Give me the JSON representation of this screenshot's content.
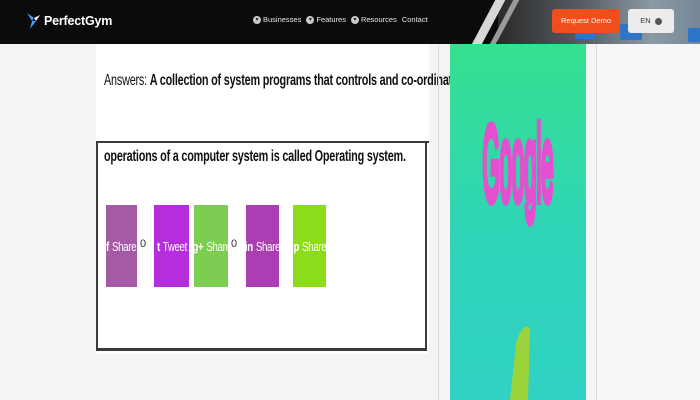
{
  "header": {
    "brand": "PerfectGym",
    "nav": [
      {
        "label": "Businesses",
        "icon": "circle-arrow-icon"
      },
      {
        "label": "Features",
        "icon": "circle-arrow-icon"
      },
      {
        "label": "Resources",
        "icon": "circle-arrow-icon"
      },
      {
        "label": "Contact",
        "icon": ""
      }
    ],
    "cta_label": "Request Demo",
    "lang_label": "EN",
    "colors": {
      "bar": "#0b0b0b",
      "cta": "#f04e1c",
      "lang_bg": "#ececec"
    }
  },
  "article": {
    "answer_label": "Answers:",
    "answer_line1": "A collection of system programs that controls and co-ordinates the overall",
    "answer_line2": "operations of a computer system is called Operating system."
  },
  "share": {
    "buttons": [
      {
        "label": "Share",
        "icon": "f",
        "icon_name": "facebook-icon",
        "color": "#a45aa5"
      },
      {
        "label": "Tweet",
        "icon": "t",
        "icon_name": "twitter-icon",
        "color": "#b52ddc"
      },
      {
        "label": "Share",
        "icon": "g+",
        "icon_name": "google-plus-icon",
        "color": "#7ccd52"
      },
      {
        "label": "Share",
        "icon": "in",
        "icon_name": "linkedin-icon",
        "color": "#ac3eb4"
      },
      {
        "label": "Share",
        "icon": "p",
        "icon_name": "pinterest-icon",
        "color": "#8ddc1a"
      }
    ],
    "counts": [
      "0",
      "0"
    ]
  },
  "ad": {
    "word": "Google",
    "colors": {
      "bg_top": "#36e08f",
      "letters": "#e44fd0",
      "inner": "#f0e641"
    }
  }
}
